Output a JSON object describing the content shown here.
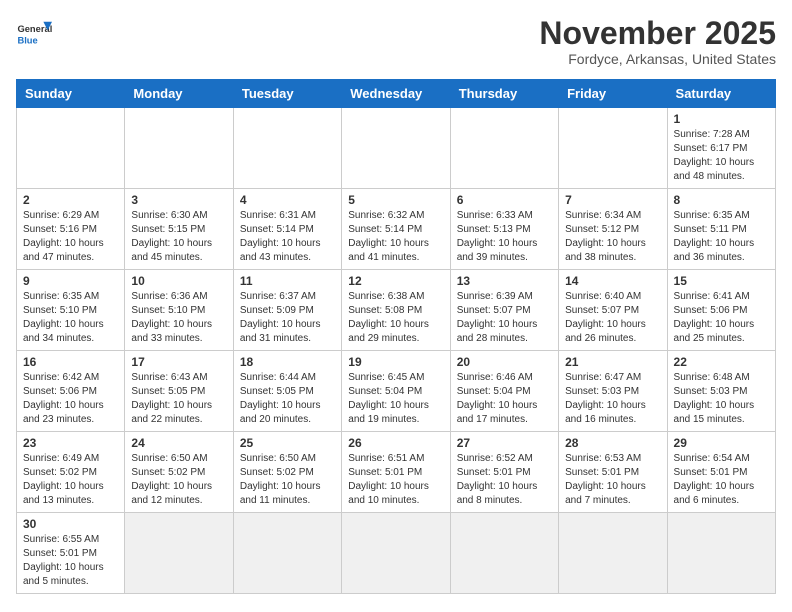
{
  "header": {
    "logo_general": "General",
    "logo_blue": "Blue",
    "month": "November 2025",
    "location": "Fordyce, Arkansas, United States"
  },
  "weekdays": [
    "Sunday",
    "Monday",
    "Tuesday",
    "Wednesday",
    "Thursday",
    "Friday",
    "Saturday"
  ],
  "weeks": [
    [
      {
        "day": "",
        "info": ""
      },
      {
        "day": "",
        "info": ""
      },
      {
        "day": "",
        "info": ""
      },
      {
        "day": "",
        "info": ""
      },
      {
        "day": "",
        "info": ""
      },
      {
        "day": "",
        "info": ""
      },
      {
        "day": "1",
        "info": "Sunrise: 7:28 AM\nSunset: 6:17 PM\nDaylight: 10 hours\nand 48 minutes."
      }
    ],
    [
      {
        "day": "2",
        "info": "Sunrise: 6:29 AM\nSunset: 5:16 PM\nDaylight: 10 hours\nand 47 minutes."
      },
      {
        "day": "3",
        "info": "Sunrise: 6:30 AM\nSunset: 5:15 PM\nDaylight: 10 hours\nand 45 minutes."
      },
      {
        "day": "4",
        "info": "Sunrise: 6:31 AM\nSunset: 5:14 PM\nDaylight: 10 hours\nand 43 minutes."
      },
      {
        "day": "5",
        "info": "Sunrise: 6:32 AM\nSunset: 5:14 PM\nDaylight: 10 hours\nand 41 minutes."
      },
      {
        "day": "6",
        "info": "Sunrise: 6:33 AM\nSunset: 5:13 PM\nDaylight: 10 hours\nand 39 minutes."
      },
      {
        "day": "7",
        "info": "Sunrise: 6:34 AM\nSunset: 5:12 PM\nDaylight: 10 hours\nand 38 minutes."
      },
      {
        "day": "8",
        "info": "Sunrise: 6:35 AM\nSunset: 5:11 PM\nDaylight: 10 hours\nand 36 minutes."
      }
    ],
    [
      {
        "day": "9",
        "info": "Sunrise: 6:35 AM\nSunset: 5:10 PM\nDaylight: 10 hours\nand 34 minutes."
      },
      {
        "day": "10",
        "info": "Sunrise: 6:36 AM\nSunset: 5:10 PM\nDaylight: 10 hours\nand 33 minutes."
      },
      {
        "day": "11",
        "info": "Sunrise: 6:37 AM\nSunset: 5:09 PM\nDaylight: 10 hours\nand 31 minutes."
      },
      {
        "day": "12",
        "info": "Sunrise: 6:38 AM\nSunset: 5:08 PM\nDaylight: 10 hours\nand 29 minutes."
      },
      {
        "day": "13",
        "info": "Sunrise: 6:39 AM\nSunset: 5:07 PM\nDaylight: 10 hours\nand 28 minutes."
      },
      {
        "day": "14",
        "info": "Sunrise: 6:40 AM\nSunset: 5:07 PM\nDaylight: 10 hours\nand 26 minutes."
      },
      {
        "day": "15",
        "info": "Sunrise: 6:41 AM\nSunset: 5:06 PM\nDaylight: 10 hours\nand 25 minutes."
      }
    ],
    [
      {
        "day": "16",
        "info": "Sunrise: 6:42 AM\nSunset: 5:06 PM\nDaylight: 10 hours\nand 23 minutes."
      },
      {
        "day": "17",
        "info": "Sunrise: 6:43 AM\nSunset: 5:05 PM\nDaylight: 10 hours\nand 22 minutes."
      },
      {
        "day": "18",
        "info": "Sunrise: 6:44 AM\nSunset: 5:05 PM\nDaylight: 10 hours\nand 20 minutes."
      },
      {
        "day": "19",
        "info": "Sunrise: 6:45 AM\nSunset: 5:04 PM\nDaylight: 10 hours\nand 19 minutes."
      },
      {
        "day": "20",
        "info": "Sunrise: 6:46 AM\nSunset: 5:04 PM\nDaylight: 10 hours\nand 17 minutes."
      },
      {
        "day": "21",
        "info": "Sunrise: 6:47 AM\nSunset: 5:03 PM\nDaylight: 10 hours\nand 16 minutes."
      },
      {
        "day": "22",
        "info": "Sunrise: 6:48 AM\nSunset: 5:03 PM\nDaylight: 10 hours\nand 15 minutes."
      }
    ],
    [
      {
        "day": "23",
        "info": "Sunrise: 6:49 AM\nSunset: 5:02 PM\nDaylight: 10 hours\nand 13 minutes."
      },
      {
        "day": "24",
        "info": "Sunrise: 6:50 AM\nSunset: 5:02 PM\nDaylight: 10 hours\nand 12 minutes."
      },
      {
        "day": "25",
        "info": "Sunrise: 6:50 AM\nSunset: 5:02 PM\nDaylight: 10 hours\nand 11 minutes."
      },
      {
        "day": "26",
        "info": "Sunrise: 6:51 AM\nSunset: 5:01 PM\nDaylight: 10 hours\nand 10 minutes."
      },
      {
        "day": "27",
        "info": "Sunrise: 6:52 AM\nSunset: 5:01 PM\nDaylight: 10 hours\nand 8 minutes."
      },
      {
        "day": "28",
        "info": "Sunrise: 6:53 AM\nSunset: 5:01 PM\nDaylight: 10 hours\nand 7 minutes."
      },
      {
        "day": "29",
        "info": "Sunrise: 6:54 AM\nSunset: 5:01 PM\nDaylight: 10 hours\nand 6 minutes."
      }
    ],
    [
      {
        "day": "30",
        "info": "Sunrise: 6:55 AM\nSunset: 5:01 PM\nDaylight: 10 hours\nand 5 minutes."
      },
      {
        "day": "",
        "info": ""
      },
      {
        "day": "",
        "info": ""
      },
      {
        "day": "",
        "info": ""
      },
      {
        "day": "",
        "info": ""
      },
      {
        "day": "",
        "info": ""
      },
      {
        "day": "",
        "info": ""
      }
    ]
  ]
}
